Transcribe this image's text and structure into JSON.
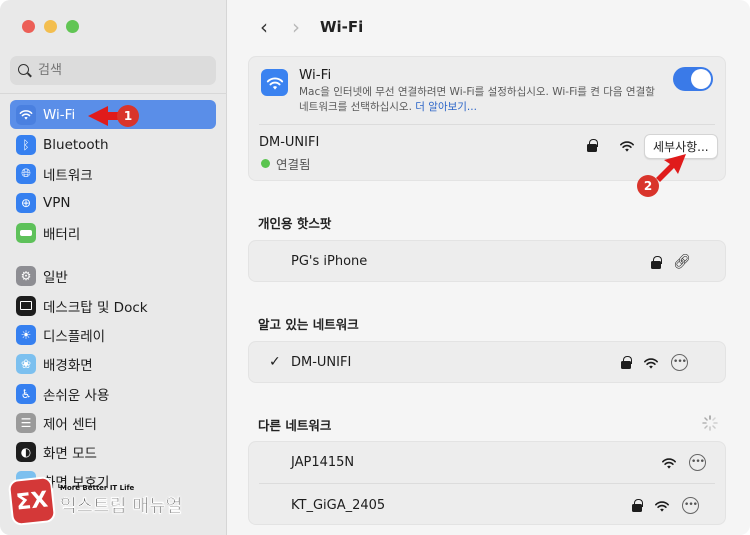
{
  "window": {
    "title": "Wi-Fi"
  },
  "sidebar": {
    "search_placeholder": "검색",
    "items": [
      {
        "label": "Wi-Fi",
        "icon": "wifi-icon",
        "active": true
      },
      {
        "label": "Bluetooth",
        "icon": "bluetooth-icon"
      },
      {
        "label": "네트워크",
        "icon": "globe-icon"
      },
      {
        "label": "VPN",
        "icon": "vpn-globe-icon"
      },
      {
        "label": "배터리",
        "icon": "battery-icon"
      },
      {
        "label": "일반",
        "icon": "gear-icon"
      },
      {
        "label": "데스크탑 및 Dock",
        "icon": "dock-icon"
      },
      {
        "label": "디스플레이",
        "icon": "sun-icon"
      },
      {
        "label": "배경화면",
        "icon": "flower-icon"
      },
      {
        "label": "손쉬운 사용",
        "icon": "accessibility-icon"
      },
      {
        "label": "제어 센터",
        "icon": "control-center-icon"
      },
      {
        "label": "화면 모드",
        "icon": "appearance-icon"
      },
      {
        "label": "화면 보호기",
        "icon": "screensaver-icon"
      }
    ]
  },
  "header": {
    "back": "‹",
    "forward": "›",
    "title": "Wi-Fi"
  },
  "wifi_card": {
    "title": "Wi-Fi",
    "description": "Mac을 인터넷에 무선 연결하려면 Wi-Fi를 설정하십시오. Wi-Fi를 켠 다음 연결할 네트워크를 선택하십시오.",
    "learn_more": "더 알아보기...",
    "enabled": true,
    "current_network": "DM-UNIFI",
    "status": "연결됨",
    "details_button": "세부사항..."
  },
  "hotspot": {
    "heading": "개인용 핫스팟",
    "networks": [
      {
        "name": "PG's iPhone",
        "locked": true,
        "icon": "link-icon"
      }
    ]
  },
  "known": {
    "heading": "알고 있는 네트워크",
    "networks": [
      {
        "name": "DM-UNIFI",
        "checked": true,
        "locked": true
      }
    ]
  },
  "other": {
    "heading": "다른 네트워크",
    "networks": [
      {
        "name": "JAP1415N",
        "locked": false
      },
      {
        "name": "KT_GiGA_2405",
        "locked": true
      }
    ]
  },
  "annotations": {
    "step1": "1",
    "step2": "2"
  },
  "watermark": {
    "sub": "More Better IT Life",
    "main": "익스트림 매뉴얼",
    "logo": "ΣX"
  },
  "colors": {
    "accent": "#3a7ae8",
    "sidebar_active": "#5a8ee8",
    "connected": "#5ac44f",
    "annotation": "#d9342b"
  }
}
